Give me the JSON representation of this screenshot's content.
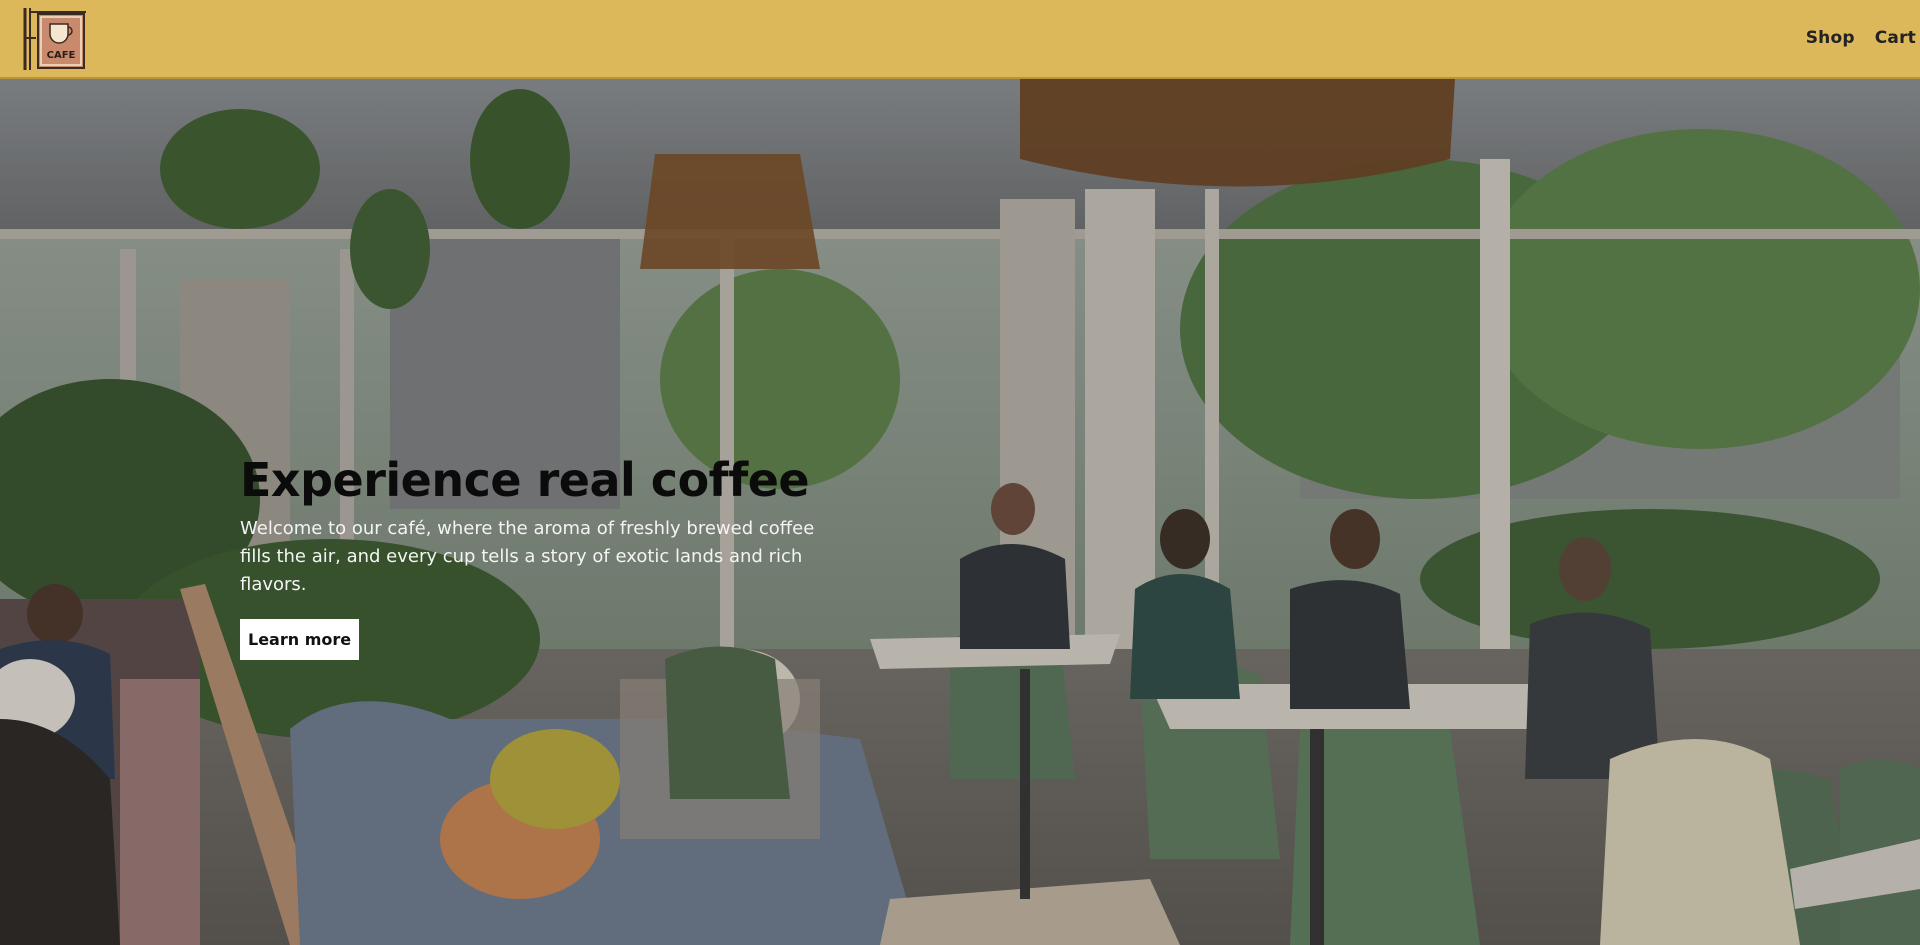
{
  "header": {
    "logo_icon": "cafe-sign-icon",
    "logo_text": "CAFE",
    "background_color": "#ddb85a",
    "nav": [
      {
        "label": "Shop"
      },
      {
        "label": "Cart"
      }
    ]
  },
  "hero": {
    "title": "Experience real coffee",
    "description": "Welcome to our café, where the aroma of freshly brewed coffee fills the air, and every cup tells a story of exotic lands and rich flavors.",
    "button_label": "Learn more",
    "background_image": "cafe-interior-photo"
  }
}
